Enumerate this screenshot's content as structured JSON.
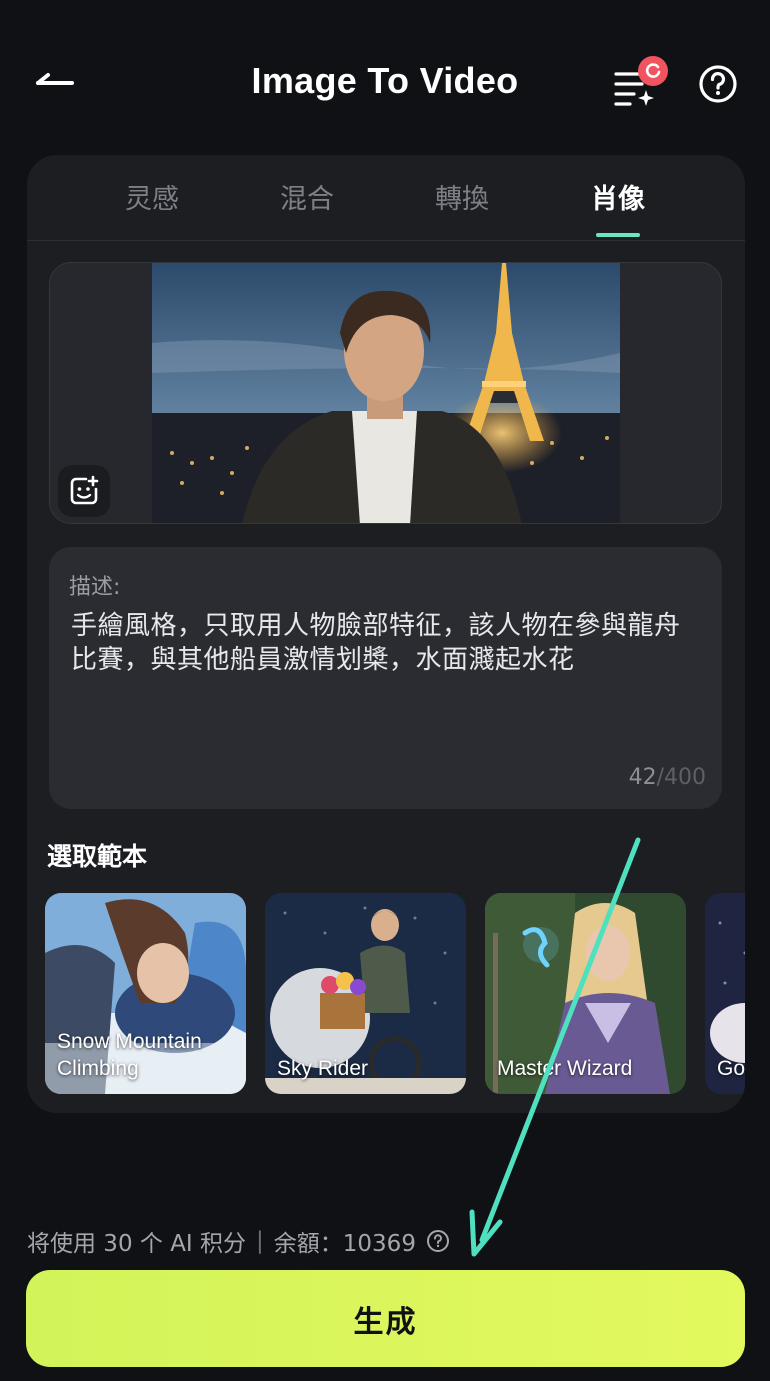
{
  "header": {
    "title": "Image To Video",
    "back_icon": "back-arrow-icon",
    "tasks_icon": "sparkle-list-icon",
    "tasks_badge_icon": "loading-spinner-icon",
    "help_icon": "question-circle-icon"
  },
  "tabs": [
    {
      "label": "灵感",
      "active": false
    },
    {
      "label": "混合",
      "active": false
    },
    {
      "label": "轉換",
      "active": false
    },
    {
      "label": "肖像",
      "active": true
    }
  ],
  "image_upload": {
    "upload_icon": "add-image-icon"
  },
  "description": {
    "label": "描述:",
    "text": "手繪風格，只取用人物臉部特征，該人物在參與龍舟比賽，與其他船員激情划槳，水面濺起水花",
    "count": "42",
    "max": "/400"
  },
  "templates": {
    "title": "選取範本",
    "items": [
      {
        "name": "Snow Mountain Climbing"
      },
      {
        "name": "Sky Rider"
      },
      {
        "name": "Master Wizard"
      },
      {
        "name": "Go"
      }
    ]
  },
  "credits": {
    "text": "将使用 30 个 AI 积分",
    "separator": "|",
    "balance": "余額：10369",
    "help_icon": "question-circle-icon"
  },
  "generate": {
    "label": "生成"
  },
  "colors": {
    "accent_green": "#d6f55b",
    "tab_indicator": "#6ce6c0",
    "badge_red": "#f1545e",
    "annotation_arrow": "#4fe0c0"
  }
}
